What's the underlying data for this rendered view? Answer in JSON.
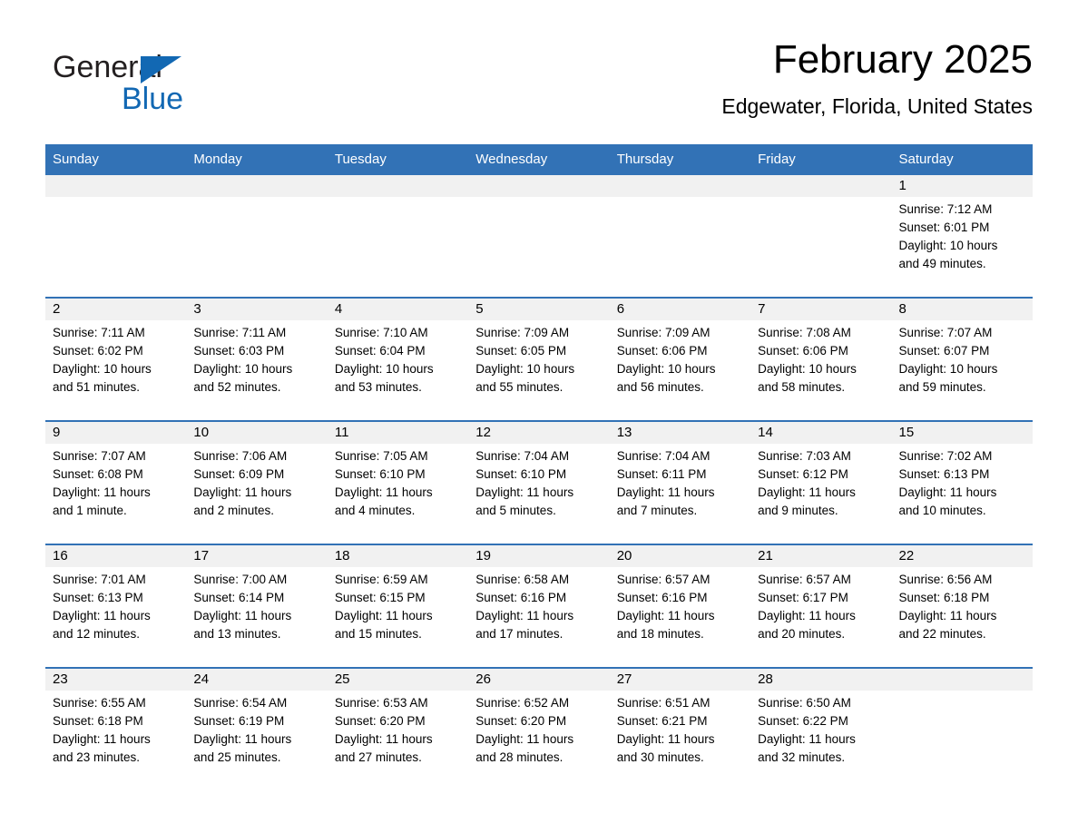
{
  "logo": {
    "text_general": "General",
    "text_blue": "Blue",
    "accent_color": "#1268b3"
  },
  "header": {
    "month_title": "February 2025",
    "location": "Edgewater, Florida, United States"
  },
  "theme": {
    "header_blue": "#3272b6",
    "daynum_band": "#f1f1f1",
    "text": "#000000"
  },
  "calendar": {
    "weekday_headers": [
      "Sunday",
      "Monday",
      "Tuesday",
      "Wednesday",
      "Thursday",
      "Friday",
      "Saturday"
    ],
    "weeks": [
      [
        {
          "day": "",
          "blank": true,
          "sunrise": "",
          "sunset": "",
          "daylight_1": "",
          "daylight_2": ""
        },
        {
          "day": "",
          "blank": true,
          "sunrise": "",
          "sunset": "",
          "daylight_1": "",
          "daylight_2": ""
        },
        {
          "day": "",
          "blank": true,
          "sunrise": "",
          "sunset": "",
          "daylight_1": "",
          "daylight_2": ""
        },
        {
          "day": "",
          "blank": true,
          "sunrise": "",
          "sunset": "",
          "daylight_1": "",
          "daylight_2": ""
        },
        {
          "day": "",
          "blank": true,
          "sunrise": "",
          "sunset": "",
          "daylight_1": "",
          "daylight_2": ""
        },
        {
          "day": "",
          "blank": true,
          "sunrise": "",
          "sunset": "",
          "daylight_1": "",
          "daylight_2": ""
        },
        {
          "day": "1",
          "blank": false,
          "sunrise": "Sunrise: 7:12 AM",
          "sunset": "Sunset: 6:01 PM",
          "daylight_1": "Daylight: 10 hours",
          "daylight_2": "and 49 minutes."
        }
      ],
      [
        {
          "day": "2",
          "blank": false,
          "sunrise": "Sunrise: 7:11 AM",
          "sunset": "Sunset: 6:02 PM",
          "daylight_1": "Daylight: 10 hours",
          "daylight_2": "and 51 minutes."
        },
        {
          "day": "3",
          "blank": false,
          "sunrise": "Sunrise: 7:11 AM",
          "sunset": "Sunset: 6:03 PM",
          "daylight_1": "Daylight: 10 hours",
          "daylight_2": "and 52 minutes."
        },
        {
          "day": "4",
          "blank": false,
          "sunrise": "Sunrise: 7:10 AM",
          "sunset": "Sunset: 6:04 PM",
          "daylight_1": "Daylight: 10 hours",
          "daylight_2": "and 53 minutes."
        },
        {
          "day": "5",
          "blank": false,
          "sunrise": "Sunrise: 7:09 AM",
          "sunset": "Sunset: 6:05 PM",
          "daylight_1": "Daylight: 10 hours",
          "daylight_2": "and 55 minutes."
        },
        {
          "day": "6",
          "blank": false,
          "sunrise": "Sunrise: 7:09 AM",
          "sunset": "Sunset: 6:06 PM",
          "daylight_1": "Daylight: 10 hours",
          "daylight_2": "and 56 minutes."
        },
        {
          "day": "7",
          "blank": false,
          "sunrise": "Sunrise: 7:08 AM",
          "sunset": "Sunset: 6:06 PM",
          "daylight_1": "Daylight: 10 hours",
          "daylight_2": "and 58 minutes."
        },
        {
          "day": "8",
          "blank": false,
          "sunrise": "Sunrise: 7:07 AM",
          "sunset": "Sunset: 6:07 PM",
          "daylight_1": "Daylight: 10 hours",
          "daylight_2": "and 59 minutes."
        }
      ],
      [
        {
          "day": "9",
          "blank": false,
          "sunrise": "Sunrise: 7:07 AM",
          "sunset": "Sunset: 6:08 PM",
          "daylight_1": "Daylight: 11 hours",
          "daylight_2": "and 1 minute."
        },
        {
          "day": "10",
          "blank": false,
          "sunrise": "Sunrise: 7:06 AM",
          "sunset": "Sunset: 6:09 PM",
          "daylight_1": "Daylight: 11 hours",
          "daylight_2": "and 2 minutes."
        },
        {
          "day": "11",
          "blank": false,
          "sunrise": "Sunrise: 7:05 AM",
          "sunset": "Sunset: 6:10 PM",
          "daylight_1": "Daylight: 11 hours",
          "daylight_2": "and 4 minutes."
        },
        {
          "day": "12",
          "blank": false,
          "sunrise": "Sunrise: 7:04 AM",
          "sunset": "Sunset: 6:10 PM",
          "daylight_1": "Daylight: 11 hours",
          "daylight_2": "and 5 minutes."
        },
        {
          "day": "13",
          "blank": false,
          "sunrise": "Sunrise: 7:04 AM",
          "sunset": "Sunset: 6:11 PM",
          "daylight_1": "Daylight: 11 hours",
          "daylight_2": "and 7 minutes."
        },
        {
          "day": "14",
          "blank": false,
          "sunrise": "Sunrise: 7:03 AM",
          "sunset": "Sunset: 6:12 PM",
          "daylight_1": "Daylight: 11 hours",
          "daylight_2": "and 9 minutes."
        },
        {
          "day": "15",
          "blank": false,
          "sunrise": "Sunrise: 7:02 AM",
          "sunset": "Sunset: 6:13 PM",
          "daylight_1": "Daylight: 11 hours",
          "daylight_2": "and 10 minutes."
        }
      ],
      [
        {
          "day": "16",
          "blank": false,
          "sunrise": "Sunrise: 7:01 AM",
          "sunset": "Sunset: 6:13 PM",
          "daylight_1": "Daylight: 11 hours",
          "daylight_2": "and 12 minutes."
        },
        {
          "day": "17",
          "blank": false,
          "sunrise": "Sunrise: 7:00 AM",
          "sunset": "Sunset: 6:14 PM",
          "daylight_1": "Daylight: 11 hours",
          "daylight_2": "and 13 minutes."
        },
        {
          "day": "18",
          "blank": false,
          "sunrise": "Sunrise: 6:59 AM",
          "sunset": "Sunset: 6:15 PM",
          "daylight_1": "Daylight: 11 hours",
          "daylight_2": "and 15 minutes."
        },
        {
          "day": "19",
          "blank": false,
          "sunrise": "Sunrise: 6:58 AM",
          "sunset": "Sunset: 6:16 PM",
          "daylight_1": "Daylight: 11 hours",
          "daylight_2": "and 17 minutes."
        },
        {
          "day": "20",
          "blank": false,
          "sunrise": "Sunrise: 6:57 AM",
          "sunset": "Sunset: 6:16 PM",
          "daylight_1": "Daylight: 11 hours",
          "daylight_2": "and 18 minutes."
        },
        {
          "day": "21",
          "blank": false,
          "sunrise": "Sunrise: 6:57 AM",
          "sunset": "Sunset: 6:17 PM",
          "daylight_1": "Daylight: 11 hours",
          "daylight_2": "and 20 minutes."
        },
        {
          "day": "22",
          "blank": false,
          "sunrise": "Sunrise: 6:56 AM",
          "sunset": "Sunset: 6:18 PM",
          "daylight_1": "Daylight: 11 hours",
          "daylight_2": "and 22 minutes."
        }
      ],
      [
        {
          "day": "23",
          "blank": false,
          "sunrise": "Sunrise: 6:55 AM",
          "sunset": "Sunset: 6:18 PM",
          "daylight_1": "Daylight: 11 hours",
          "daylight_2": "and 23 minutes."
        },
        {
          "day": "24",
          "blank": false,
          "sunrise": "Sunrise: 6:54 AM",
          "sunset": "Sunset: 6:19 PM",
          "daylight_1": "Daylight: 11 hours",
          "daylight_2": "and 25 minutes."
        },
        {
          "day": "25",
          "blank": false,
          "sunrise": "Sunrise: 6:53 AM",
          "sunset": "Sunset: 6:20 PM",
          "daylight_1": "Daylight: 11 hours",
          "daylight_2": "and 27 minutes."
        },
        {
          "day": "26",
          "blank": false,
          "sunrise": "Sunrise: 6:52 AM",
          "sunset": "Sunset: 6:20 PM",
          "daylight_1": "Daylight: 11 hours",
          "daylight_2": "and 28 minutes."
        },
        {
          "day": "27",
          "blank": false,
          "sunrise": "Sunrise: 6:51 AM",
          "sunset": "Sunset: 6:21 PM",
          "daylight_1": "Daylight: 11 hours",
          "daylight_2": "and 30 minutes."
        },
        {
          "day": "28",
          "blank": false,
          "sunrise": "Sunrise: 6:50 AM",
          "sunset": "Sunset: 6:22 PM",
          "daylight_1": "Daylight: 11 hours",
          "daylight_2": "and 32 minutes."
        },
        {
          "day": "",
          "blank": true,
          "sunrise": "",
          "sunset": "",
          "daylight_1": "",
          "daylight_2": ""
        }
      ]
    ]
  }
}
